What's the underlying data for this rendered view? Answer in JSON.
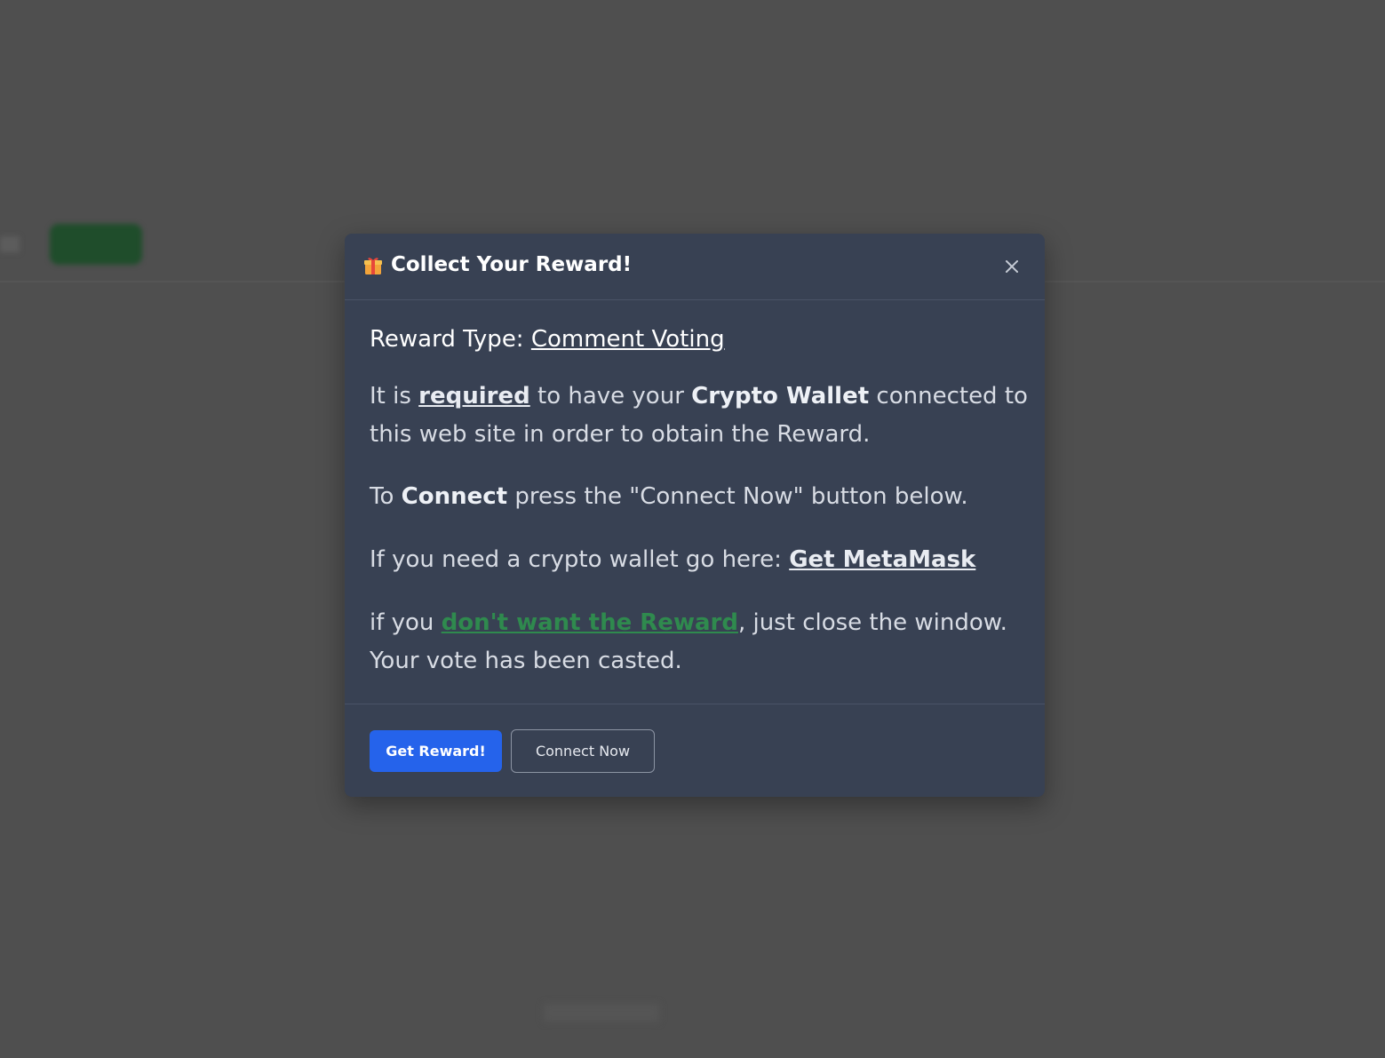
{
  "modal": {
    "title": "Collect Your Reward!",
    "gift_icon": "gift-icon",
    "close_icon": "close-icon"
  },
  "body": {
    "reward_type_label": "Reward Type: ",
    "reward_type_value": "Comment Voting",
    "required_prefix": "It is ",
    "required_word": "required",
    "required_mid": " to have your ",
    "crypto_wallet": "Crypto Wallet",
    "required_suffix": " connected to",
    "required_line2": "this web site in order to obtain the Reward.",
    "connect_prefix": "To ",
    "connect_word": "Connect",
    "connect_suffix": " press the \"Connect Now\" button below.",
    "metamask_prefix": "If you need a crypto wallet go here: ",
    "metamask_link": "Get MetaMask",
    "close_prefix": "if you ",
    "close_link": "don't want the Reward",
    "close_suffix": ", just close the window.",
    "close_line2": "Your vote has been casted."
  },
  "footer": {
    "primary_button": "Get Reward!",
    "secondary_button": "Connect Now"
  },
  "colors": {
    "backdrop": "#4f4f4f",
    "modal_bg": "#384153",
    "primary": "#2563eb",
    "green_link": "#2f8a4e"
  }
}
